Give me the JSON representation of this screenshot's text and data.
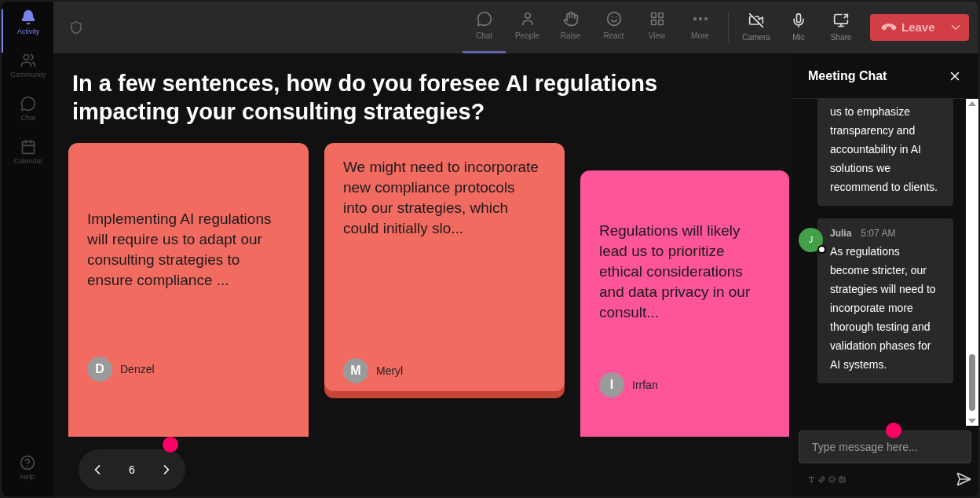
{
  "sidebar": {
    "items": [
      {
        "label": "Activity",
        "selected": true
      },
      {
        "label": "Community",
        "selected": false
      },
      {
        "label": "Chat",
        "selected": false
      },
      {
        "label": "Calendar",
        "selected": false
      }
    ],
    "help": "Help"
  },
  "toolbar": {
    "items": [
      {
        "label": "Chat",
        "selected": true
      },
      {
        "label": "People",
        "selected": false
      },
      {
        "label": "Raise",
        "selected": false
      },
      {
        "label": "React",
        "selected": false
      },
      {
        "label": "View",
        "selected": false
      },
      {
        "label": "More",
        "selected": false
      }
    ],
    "devices": [
      "Camera",
      "Mic",
      "Share"
    ],
    "leave": "Leave"
  },
  "question": "In a few sentences, how do you foresee AI regulations impacting your consulting strategies?",
  "cards": [
    {
      "text": "Implementing AI regulations will require us to adapt our consulting strategies to ensure compliance ...",
      "author": "Denzel",
      "initial": "D",
      "color": "#f26b61"
    },
    {
      "text": "We might need to incorporate new compliance protocols into our strategies, which could initially slo...",
      "author": "Meryl",
      "initial": "M",
      "color": "#f26b61"
    },
    {
      "text": "Regulations will likely lead us to prioritize ethical considerations and data privacy in our consult...",
      "author": "Irrfan",
      "initial": "I",
      "color": "#fd5598"
    }
  ],
  "pager": {
    "page": "6"
  },
  "chat": {
    "title": "Meeting Chat",
    "messages": [
      {
        "text": "us to emphasize transparency and accountability in AI solutions we recommend to clients."
      },
      {
        "author": "Julia",
        "initial": "J",
        "time": "5:07 AM",
        "text": "As regulations become stricter, our strategies will need to incorporate more thorough testing and validation phases for AI systems."
      }
    ],
    "input": {
      "placeholder": "Type message here..."
    }
  }
}
